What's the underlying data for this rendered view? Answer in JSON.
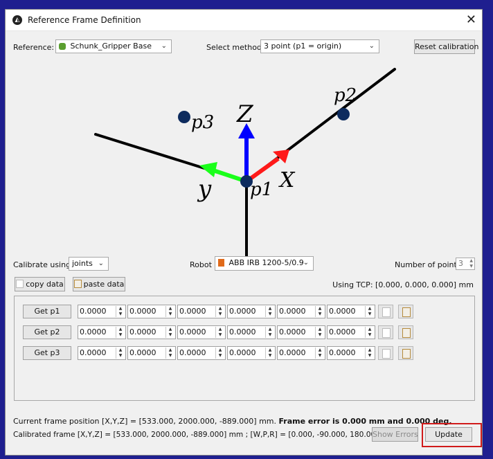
{
  "window": {
    "title": "Reference Frame Definition"
  },
  "reference": {
    "label": "Reference:",
    "value": "Schunk_Gripper Base"
  },
  "method": {
    "label": "Select method:",
    "value": "3 point (p1 = origin)"
  },
  "reset_button": "Reset calibration",
  "diagram": {
    "z": "Z",
    "x": "X",
    "y": "y",
    "p1": "p1",
    "p2": "p2",
    "p3": "p3",
    "colors": {
      "x_axis": "#ff1a1a",
      "y_axis": "#1aff1a",
      "z_axis": "#0000ff",
      "point": "#0d2b5e"
    }
  },
  "calibrate": {
    "label": "Calibrate using:",
    "value": "joints"
  },
  "robot": {
    "label": "Robot",
    "value": "ABB IRB 1200-5/0.9"
  },
  "num_points": {
    "label": "Number of points",
    "value": "3"
  },
  "copy_button": "copy data",
  "paste_button": "paste data",
  "tcp_text": "Using TCP: [0.000, 0.000, 0.000] mm",
  "points": [
    {
      "button": "Get p1",
      "values": [
        "0.0000",
        "0.0000",
        "0.0000",
        "0.0000",
        "0.0000",
        "0.0000"
      ]
    },
    {
      "button": "Get p2",
      "values": [
        "0.0000",
        "0.0000",
        "0.0000",
        "0.0000",
        "0.0000",
        "0.0000"
      ]
    },
    {
      "button": "Get p3",
      "values": [
        "0.0000",
        "0.0000",
        "0.0000",
        "0.0000",
        "0.0000",
        "0.0000"
      ]
    }
  ],
  "status": {
    "current_prefix": "Current frame position [X,Y,Z] = [533.000, 2000.000, -889.000] mm.",
    "current_error": "Frame error is 0.000 mm and 0.000 deg.",
    "calibrated": "Calibrated frame [X,Y,Z] = [533.000, 2000.000, -889.000] mm ; [W,P,R] = [0.000, -90.000, 180.000] deg"
  },
  "show_errors_button": "Show Errors",
  "update_button": "Update"
}
